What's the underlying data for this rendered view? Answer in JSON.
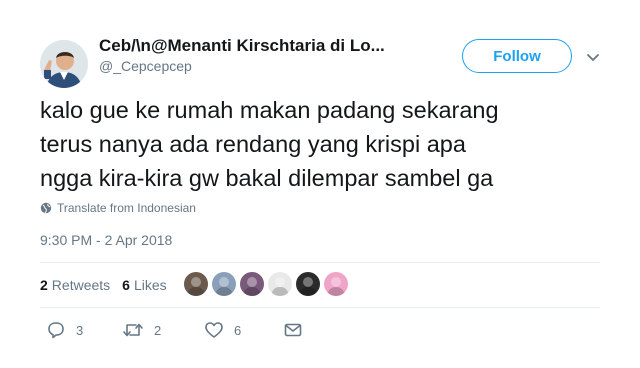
{
  "user": {
    "display_name": "Ceb/\\n@Menanti Kirschtaria di Lo...",
    "handle": "@_Cepcepcep"
  },
  "follow_label": "Follow",
  "tweet": {
    "lines": [
      "kalo gue ke rumah makan padang sekarang",
      "terus nanya ada rendang yang krispi apa",
      "ngga kira-kira gw bakal dilempar sambel ga"
    ]
  },
  "translate_label": "Translate from Indonesian",
  "timestamp": "9:30 PM - 2 Apr 2018",
  "stats": {
    "retweets_count": "2",
    "retweets_label": "Retweets",
    "likes_count": "6",
    "likes_label": "Likes"
  },
  "likers": [
    {
      "icon": "liker-avatar-1",
      "color": "#6b5a4d"
    },
    {
      "icon": "liker-avatar-2",
      "color": "#8a9fb8"
    },
    {
      "icon": "liker-avatar-3",
      "color": "#7a5a7a"
    },
    {
      "icon": "liker-avatar-4",
      "color": "#e9e9e9"
    },
    {
      "icon": "liker-avatar-5",
      "color": "#2b2b2b"
    },
    {
      "icon": "liker-avatar-6",
      "color": "#f0a5c8"
    }
  ],
  "actions": {
    "reply_count": "3",
    "retweet_count": "2",
    "like_count": "6"
  },
  "colors": {
    "accent": "#1da1f2",
    "muted": "#657786",
    "text": "#14171a"
  }
}
